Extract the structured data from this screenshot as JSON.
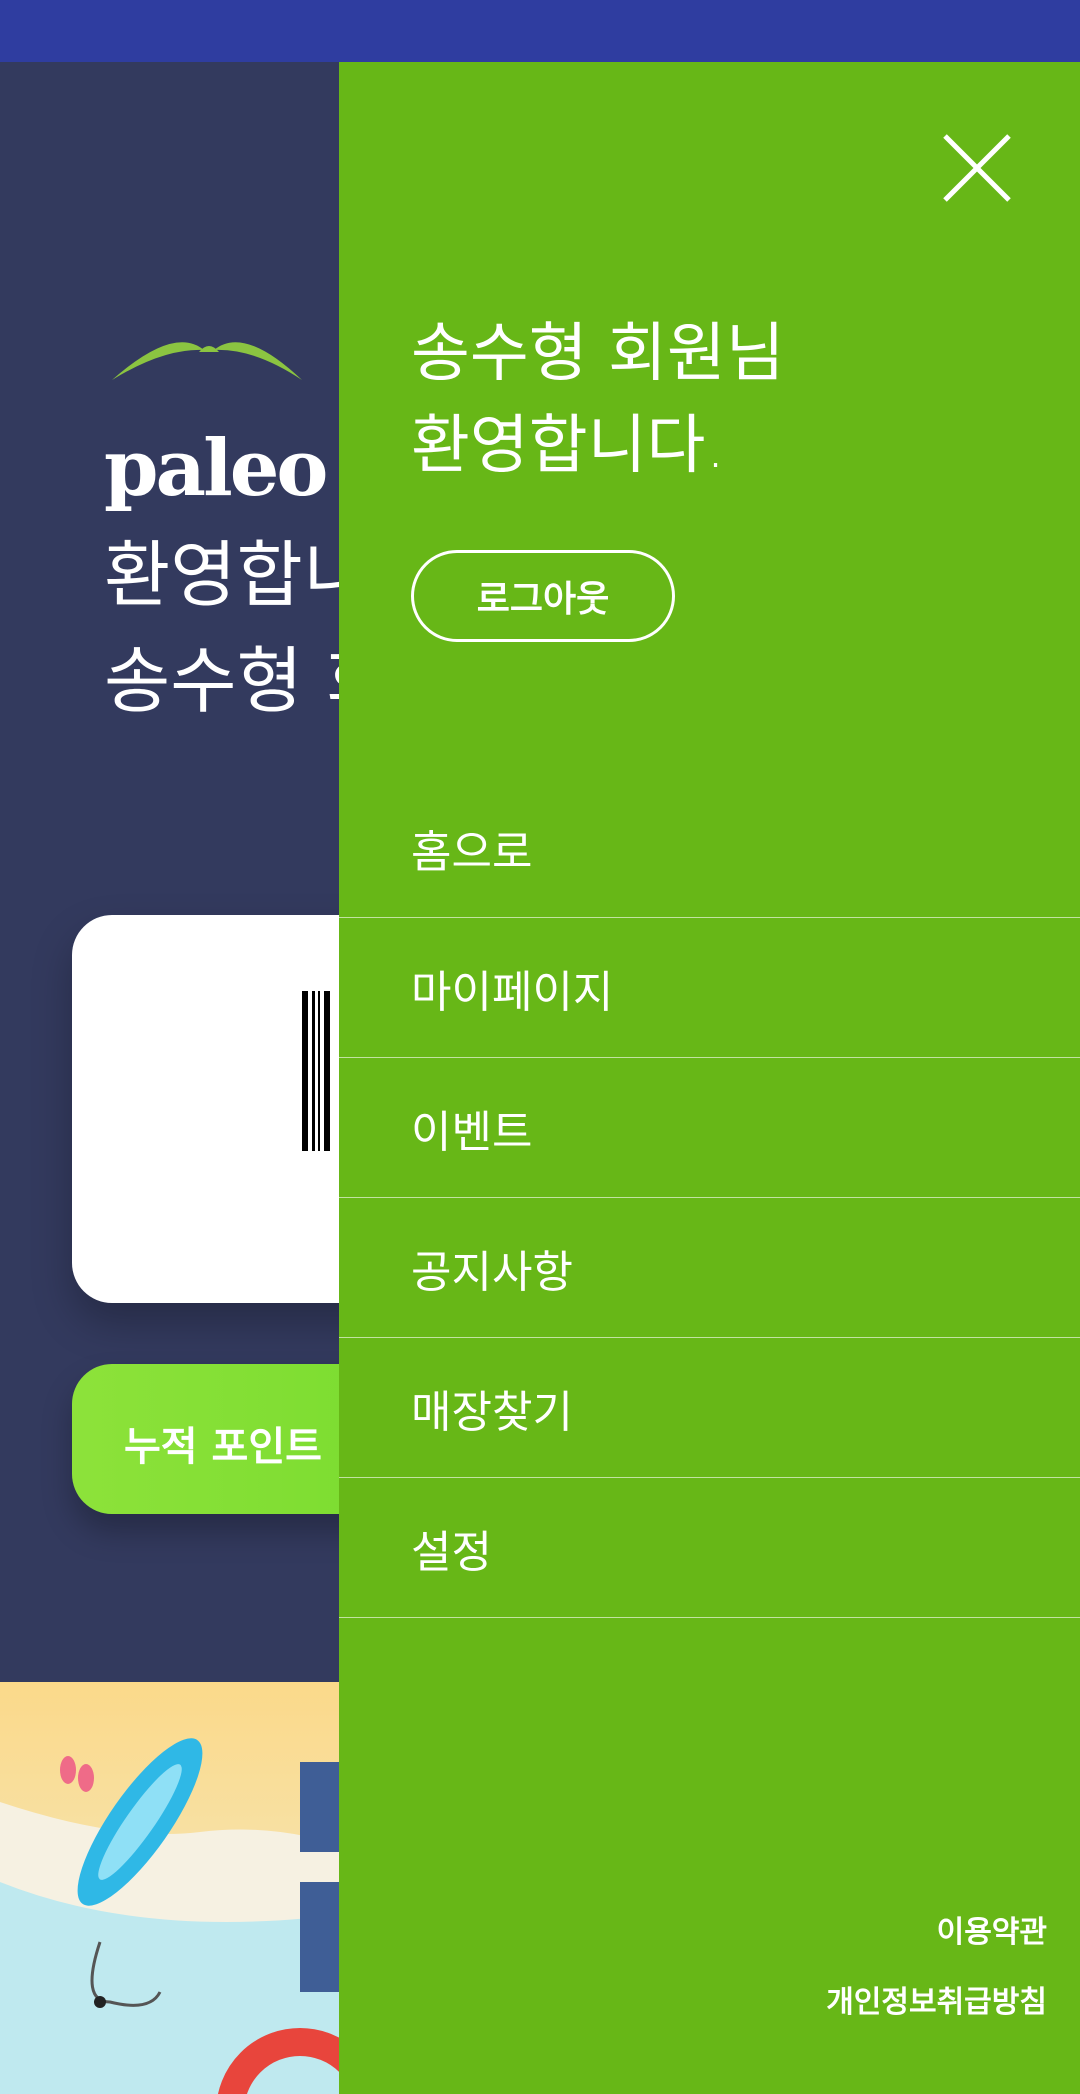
{
  "background_page": {
    "logo_text": "paleo",
    "welcome_line1": "환영합니",
    "welcome_line2": "송수형 회",
    "points_label": "누적 포인트"
  },
  "drawer": {
    "greeting_line1": "송수형 회원님",
    "greeting_line2": "환영합니다.",
    "logout_label": "로그아웃",
    "menu_items": [
      {
        "label": "홈으로"
      },
      {
        "label": "마이페이지"
      },
      {
        "label": "이벤트"
      },
      {
        "label": "공지사항"
      },
      {
        "label": "매장찾기"
      },
      {
        "label": "설정"
      }
    ],
    "footer_links": [
      {
        "label": "이용약관"
      },
      {
        "label": "개인정보취급방침"
      }
    ]
  },
  "icons": {
    "close": "close-icon",
    "logo_leaf": "leaf-icon"
  },
  "colors": {
    "status_bar": "#2f3da0",
    "background": "#333a5e",
    "drawer": "#67b717",
    "points_gradient_start": "#8de23a",
    "points_gradient_end": "#5bd21e"
  }
}
